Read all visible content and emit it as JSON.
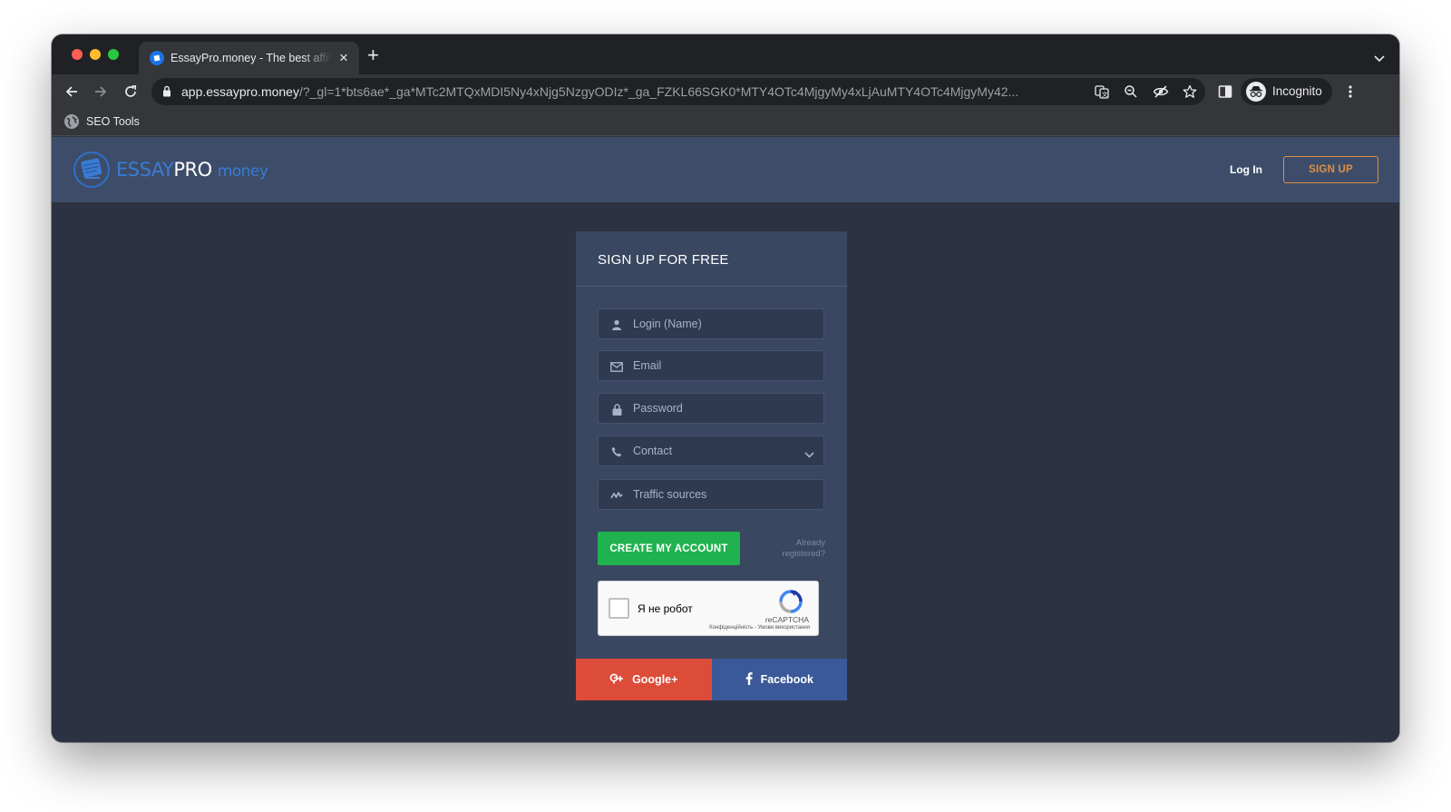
{
  "browser": {
    "tab_title": "EssayPro.money - The best affiliate program",
    "url_host": "app.essaypro.money",
    "url_rest": "/?_gl=1*bts6ae*_ga*MTc2MTQxMDI5Ny4xNjg5NzgyODIz*_ga_FZKL66SGK0*MTY4OTc4MjgyMy4xLjAuMTY4OTc4MjgyMy42...",
    "incognito_label": "Incognito",
    "bookmark_label": "SEO Tools"
  },
  "header": {
    "logo_essay": "ESSAY",
    "logo_pro": "PRO",
    "logo_money": "money",
    "login_label": "Log In",
    "signup_label": "SIGN UP"
  },
  "form": {
    "title": "SIGN UP FOR FREE",
    "login_placeholder": "Login (Name)",
    "email_placeholder": "Email",
    "password_placeholder": "Password",
    "contact_placeholder": "Contact",
    "traffic_placeholder": "Traffic sources",
    "create_label": "CREATE MY ACCOUNT",
    "already_line1": "Already",
    "already_line2": "registered?"
  },
  "recaptcha": {
    "label": "Я не робот",
    "brand": "reCAPTCHA",
    "terms": "Конфіденційність - Умови використання"
  },
  "social": {
    "google_label": "Google+",
    "facebook_label": "Facebook"
  },
  "colors": {
    "header_bg": "#3d4d69",
    "page_bg": "#2c3241",
    "card_bg": "#3a4760",
    "accent_orange": "#e08e43",
    "create_green": "#20b24f",
    "google_red": "#dd4b39",
    "facebook_blue": "#3b5998"
  }
}
